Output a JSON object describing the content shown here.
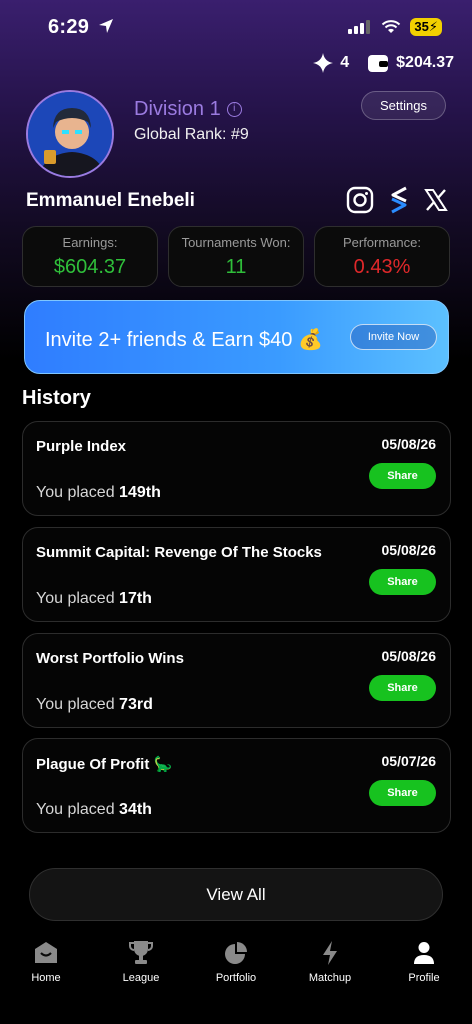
{
  "status_bar": {
    "time": "6:29",
    "battery": "35"
  },
  "topbar": {
    "gems": "4",
    "balance": "$204.37"
  },
  "profile": {
    "division": "Division 1",
    "info": "i",
    "global_rank": "Global Rank: #9",
    "settings_label": "Settings",
    "name": "Emmanuel Enebeli"
  },
  "stats": [
    {
      "label": "Earnings:",
      "value": "$604.37",
      "color": "#2fbf3a"
    },
    {
      "label": "Tournaments Won:",
      "value": "11",
      "color": "#2fbf3a"
    },
    {
      "label": "Performance:",
      "value": "0.43%",
      "color": "#e0282a"
    }
  ],
  "invite": {
    "text": "Invite 2+ friends & Earn $40",
    "emoji": "💰",
    "button": "Invite Now"
  },
  "history": {
    "title": "History",
    "prefix": "You placed",
    "share_label": "Share",
    "items": [
      {
        "name": "Purple Index",
        "date": "05/08/26",
        "place": "149th"
      },
      {
        "name": "Summit Capital: Revenge Of The Stocks",
        "date": "05/08/26",
        "place": "17th"
      },
      {
        "name": "Worst Portfolio Wins",
        "date": "05/08/26",
        "place": "73rd"
      },
      {
        "name": "Plague Of Profit 🦕",
        "date": "05/07/26",
        "place": "34th"
      }
    ]
  },
  "view_all": "View All",
  "nav": [
    {
      "label": "Home",
      "icon": "home-icon"
    },
    {
      "label": "League",
      "icon": "trophy-icon"
    },
    {
      "label": "Portfolio",
      "icon": "pie-chart-icon"
    },
    {
      "label": "Matchup",
      "icon": "lightning-icon"
    },
    {
      "label": "Profile",
      "icon": "person-icon"
    }
  ]
}
